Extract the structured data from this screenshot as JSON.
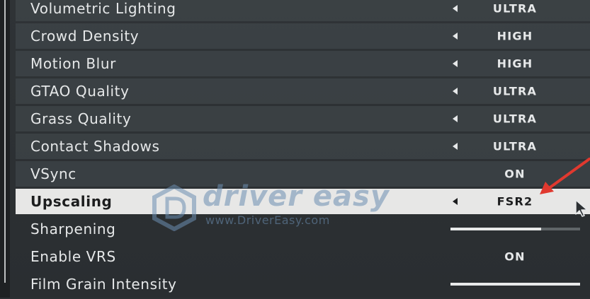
{
  "settings": [
    {
      "label": "Volumetric Lighting",
      "value": "ULTRA",
      "control": "arrow"
    },
    {
      "label": "Crowd Density",
      "value": "HIGH",
      "control": "arrow"
    },
    {
      "label": "Motion Blur",
      "value": "HIGH",
      "control": "arrow"
    },
    {
      "label": "GTAO Quality",
      "value": "ULTRA",
      "control": "arrow"
    },
    {
      "label": "Grass Quality",
      "value": "ULTRA",
      "control": "arrow"
    },
    {
      "label": "Contact Shadows",
      "value": "ULTRA",
      "control": "arrow"
    },
    {
      "label": "VSync",
      "value": "ON",
      "control": "toggle"
    },
    {
      "label": "Upscaling",
      "value": "FSR2",
      "control": "arrow",
      "selected": true
    },
    {
      "label": "Sharpening",
      "control": "slider",
      "level": 0.7
    },
    {
      "label": "Enable VRS",
      "value": "ON",
      "control": "toggle"
    },
    {
      "label": "Film Grain Intensity",
      "control": "slider",
      "level": 1.0
    }
  ],
  "watermark": {
    "brand": "driver easy",
    "url": "www.DriverEasy.com"
  },
  "colors": {
    "background": "#2c3033",
    "row": "#464c50",
    "selected_row": "#e7e7e6",
    "text": "#e6e8e9",
    "annotation": "#e0392f",
    "watermark": "#6c8fb2"
  },
  "icons": {
    "left_arrow": "left-arrow-icon",
    "annotation": "red-arrow-icon",
    "cursor": "cursor-icon",
    "watermark_logo": "driver-easy-logo-icon"
  }
}
